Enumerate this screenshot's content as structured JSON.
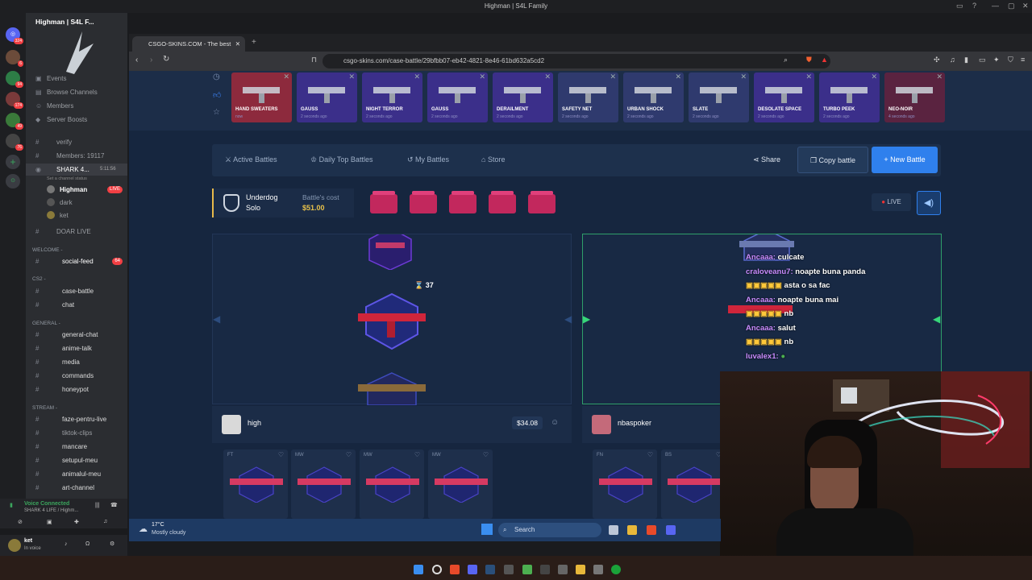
{
  "window": {
    "title": "Highman | S4L Family"
  },
  "discord": {
    "server_name": "Highman | S4L F...",
    "menu": [
      "Events",
      "Browse Channels",
      "Members",
      "Server Boosts"
    ],
    "rail_badges": [
      "324",
      "6",
      "94",
      "174",
      "49",
      "76"
    ],
    "channels": [
      {
        "name": "verify"
      },
      {
        "name": "Members: 19117"
      },
      {
        "name": "SHARK 4...",
        "time": "5:11:56",
        "status": "Set a channel status"
      },
      {
        "name": "Highman",
        "badge": "LIVE"
      },
      {
        "name": "dark"
      },
      {
        "name": "ket"
      },
      {
        "name": "DOAR LIVE"
      }
    ],
    "categories": {
      "welcome": "WELCOME - ",
      "cs2": "CS2 -",
      "general": "GENERAL -",
      "stream": "STREAM -"
    },
    "welcome_channels": [
      {
        "name": "social-feed",
        "badge": "64"
      }
    ],
    "cs2_channels": [
      "case-battle",
      "chat"
    ],
    "general_channels": [
      "general-chat",
      "anime-talk",
      "media",
      "commands",
      "honeypot"
    ],
    "stream_channels": [
      "faze-pentru-live",
      "tiktok-clips",
      "mancare",
      "setupul-meu",
      "animalul-meu",
      "art-channel"
    ],
    "voice": {
      "title": "Voice Connected",
      "sub": "SHARK 4 LIFE / Highm..."
    },
    "user": {
      "name": "ket",
      "status": "In voice"
    }
  },
  "browser": {
    "tab_title": "CSGO-SKINS.COM - The best",
    "url": "csgo-skins.com/case-battle/29bfbb07-eb42-4821-8e46-61bd632a5cd2"
  },
  "drops": [
    {
      "name": "HAND SWEATERS",
      "ago": "now",
      "color": "#8d2a3d"
    },
    {
      "name": "GAUSS",
      "ago": "2 seconds ago",
      "color": "#3b2f8a"
    },
    {
      "name": "NIGHT TERROR",
      "ago": "2 seconds ago",
      "color": "#3b2f8a"
    },
    {
      "name": "GAUSS",
      "ago": "2 seconds ago",
      "color": "#3b2f8a"
    },
    {
      "name": "DERAILMENT",
      "ago": "2 seconds ago",
      "color": "#3b2f8a"
    },
    {
      "name": "SAFETY NET",
      "ago": "2 seconds ago",
      "color": "#2f3a6e"
    },
    {
      "name": "URBAN SHOCK",
      "ago": "2 seconds ago",
      "color": "#2f3a6e"
    },
    {
      "name": "SLATE",
      "ago": "2 seconds ago",
      "color": "#2f3a6e"
    },
    {
      "name": "DESOLATE SPACE",
      "ago": "2 seconds ago",
      "color": "#3b2f8a"
    },
    {
      "name": "TURBO PEEK",
      "ago": "2 seconds ago",
      "color": "#3b2f8a"
    },
    {
      "name": "NEO-NOIR",
      "ago": "4 seconds ago",
      "color": "#5a2340"
    }
  ],
  "nav": {
    "active_battles": "Active Battles",
    "daily_top": "Daily Top Battles",
    "my_battles": "My Battles",
    "store": "Store",
    "share": "Share",
    "copy_battle": "Copy battle",
    "new_battle": "New Battle"
  },
  "battle": {
    "mode_top": "Underdog",
    "mode_sub": "Solo",
    "cost_label": "Battle's cost",
    "cost_value": "$51.00",
    "live": "LIVE",
    "spin_count": "37"
  },
  "players": [
    {
      "name": "high",
      "total": "$34.08",
      "items": [
        "FT",
        "MW",
        "MW",
        "MW"
      ]
    },
    {
      "name": "nbaspoker",
      "items": [
        "FN",
        "BS"
      ]
    }
  ],
  "chat": [
    {
      "user": "Ancaaa:",
      "msg": "culcate"
    },
    {
      "user": "craloveanu7:",
      "msg": "noapte buna panda"
    },
    {
      "user": "",
      "msg": "asta o sa fac"
    },
    {
      "user": "Ancaaa:",
      "msg": "noapte buna mai"
    },
    {
      "user": "",
      "msg": "nb"
    },
    {
      "user": "Ancaaa:",
      "msg": "salut"
    },
    {
      "user": "",
      "msg": "nb"
    },
    {
      "user": "luvalex1:",
      "msg": ""
    }
  ],
  "taskbar": {
    "temp": "17°C",
    "weather": "Mostly cloudy",
    "search": "Search"
  }
}
